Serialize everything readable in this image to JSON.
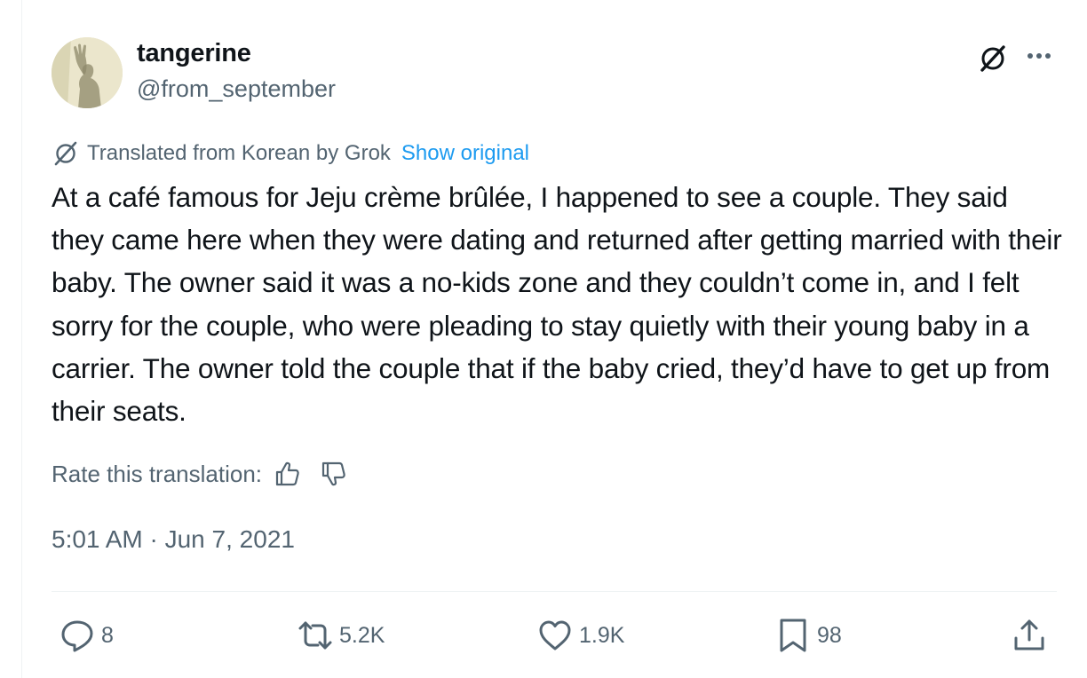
{
  "user": {
    "display_name": "tangerine",
    "handle": "@from_september"
  },
  "translation": {
    "notice": "Translated from Korean by Grok",
    "show_original": "Show original"
  },
  "tweet": {
    "text": "At a café famous for Jeju crème brûlée, I happened to see a couple. They said they came here when they were dating and returned after getting married with their baby. The owner said it was a no-kids zone and they couldn’t come in, and I felt sorry for the couple, who were pleading to stay quietly with their young baby in a carrier. The owner told the couple that if the baby cried, they’d have to get up from their seats.",
    "timestamp": "5:01 AM · Jun 7, 2021"
  },
  "rate": {
    "label": "Rate this translation:"
  },
  "actions": {
    "replies": "8",
    "reposts": "5.2K",
    "likes": "1.9K",
    "bookmarks": "98"
  },
  "icons": {
    "grok": "grok-icon",
    "more": "more-icon",
    "thumbs_up": "thumbs-up-icon",
    "thumbs_down": "thumbs-down-icon",
    "reply": "reply-icon",
    "repost": "repost-icon",
    "like": "heart-icon",
    "bookmark": "bookmark-icon",
    "share": "share-icon"
  },
  "colors": {
    "text": "#0f1419",
    "secondary": "#536471",
    "link": "#1d9bf0",
    "divider": "#eff3f4"
  }
}
